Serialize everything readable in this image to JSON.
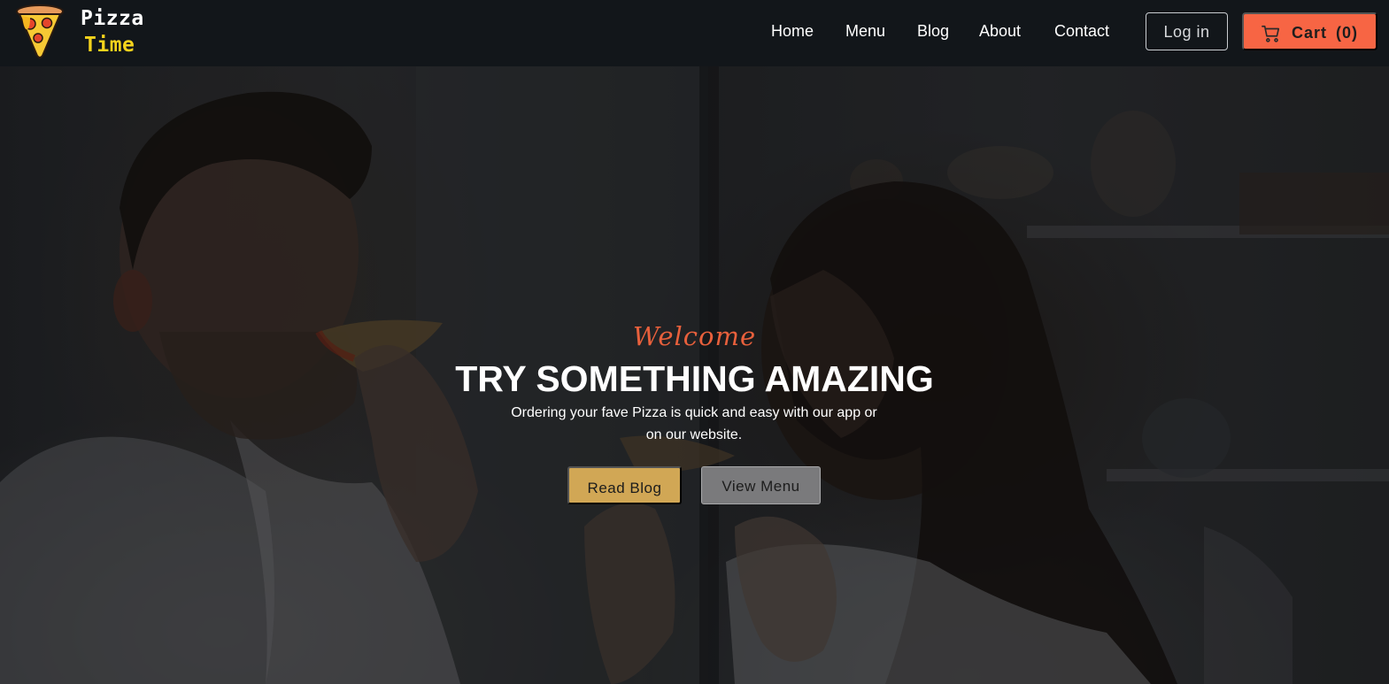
{
  "brand": {
    "line1": "Pizza",
    "line2": "Time",
    "logo_icon": "pizza-slice-icon",
    "line1_color": "#ffffff",
    "line2_color": "#f5d31c"
  },
  "nav": {
    "items": [
      {
        "label": "Home"
      },
      {
        "label": "Menu"
      },
      {
        "label": "Blog"
      },
      {
        "label": "About"
      },
      {
        "label": "Contact"
      }
    ],
    "login_label": "Log in",
    "cart_label": "Cart",
    "cart_count": "(0)",
    "cart_icon": "shopping-cart-icon"
  },
  "hero": {
    "welcome": "Welcome",
    "title": "TRY SOMETHING AMAZING",
    "text": "Ordering your fave Pizza is quick and easy with our app or on our website.",
    "primary_button": "Read Blog",
    "secondary_button": "View Menu"
  },
  "colors": {
    "header_bg": "#12161a",
    "accent": "#f76544",
    "welcome": "#e8603c",
    "primary_button": "#d1a755",
    "secondary_button": "#7a7a7c"
  }
}
